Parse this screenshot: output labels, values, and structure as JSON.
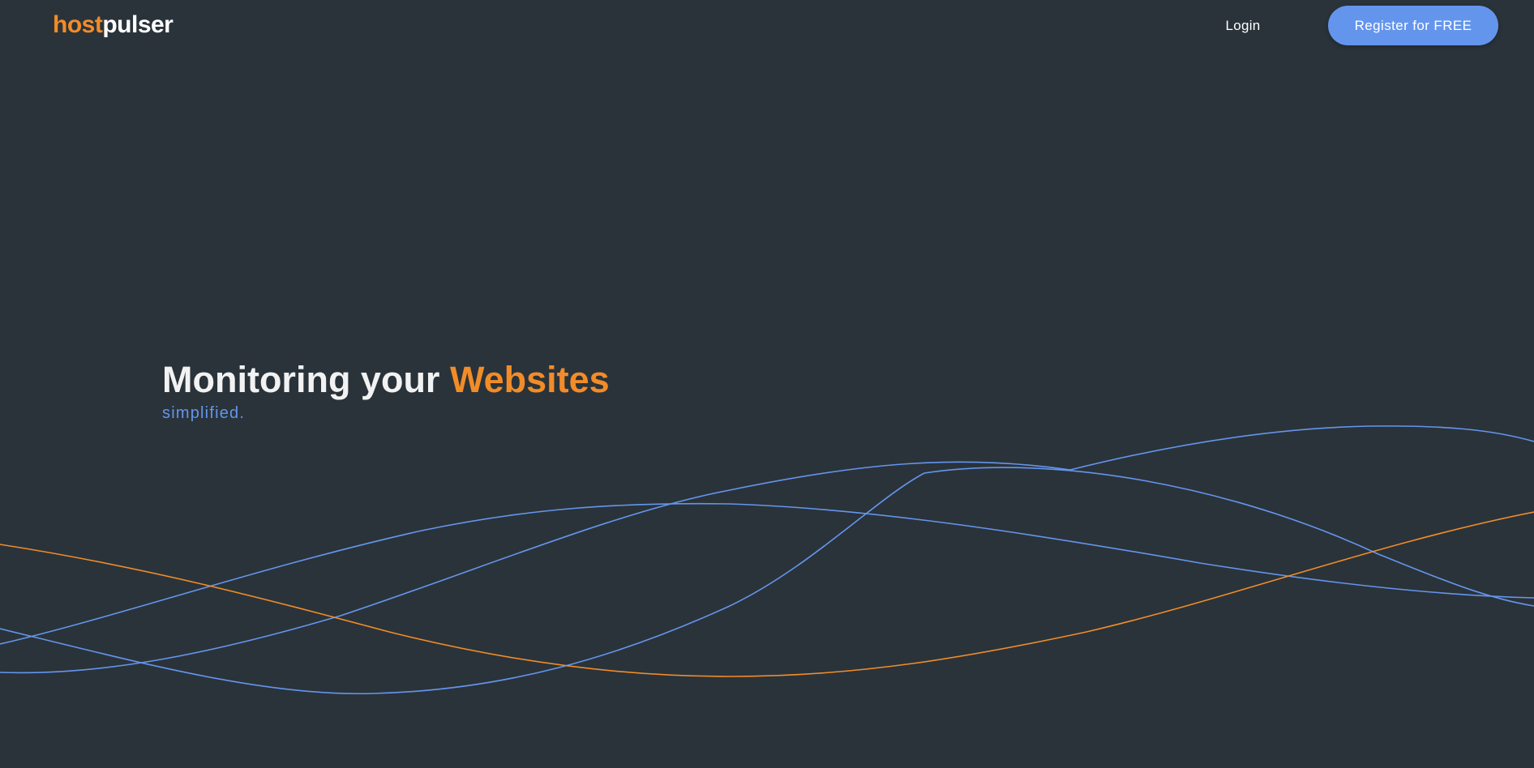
{
  "brand": {
    "logo_part_a": "host",
    "logo_part_b": "pulser"
  },
  "nav": {
    "login_label": "Login",
    "register_label": "Register for FREE"
  },
  "hero": {
    "title_main": "Monitoring your ",
    "title_accent": "Websites",
    "subtitle": "simplified."
  },
  "colors": {
    "background": "#2a333a",
    "accent_orange": "#f28c28",
    "accent_blue": "#6495ed",
    "text_light": "#f2f2f2"
  }
}
